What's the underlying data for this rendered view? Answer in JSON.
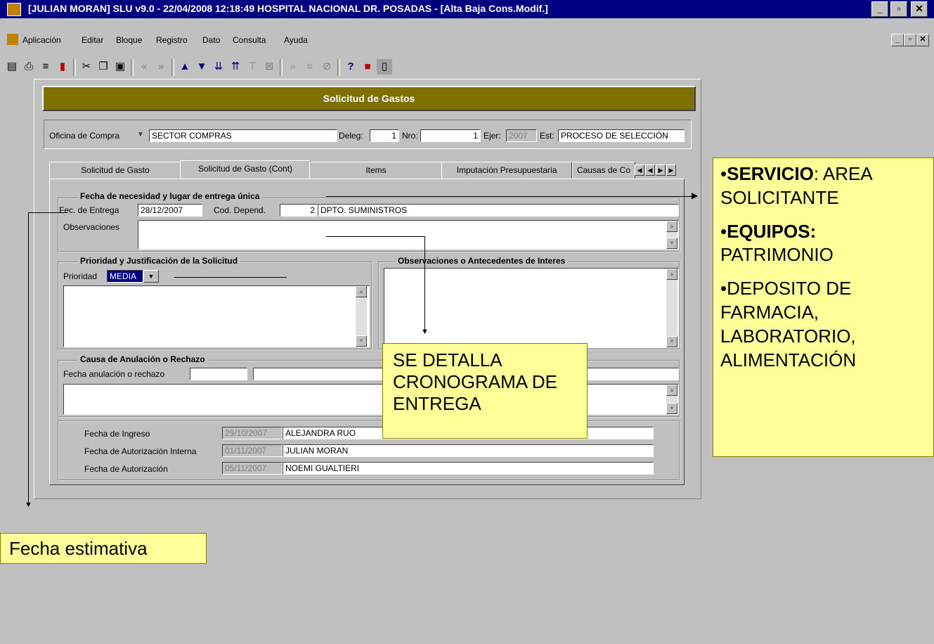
{
  "window": {
    "title": "[JULIAN MORAN]  SLU v9.0 - 22/04/2008 12:18:49 HOSPITAL NACIONAL DR. POSADAS - [Alta Baja Cons.Modif.]"
  },
  "menu": [
    "Aplicación",
    "Editar",
    "Bloque",
    "Registro",
    "Dato",
    "Consulta",
    "Ayuda"
  ],
  "form": {
    "title": "Solicitud de Gastos",
    "header": {
      "oficina_label": "Oficina de Compra",
      "oficina_value": "SECTOR COMPRAS",
      "deleg_label": "Deleg:",
      "deleg_value": "1",
      "nro_label": "Nro:",
      "nro_value": "1",
      "ejer_label": "Ejer:",
      "ejer_value": "2007",
      "est_label": "Est:",
      "est_value": "PROCESO DE SELECCIÓN"
    },
    "tabs": [
      "Solicitud de Gasto",
      "Solicitud de Gasto (Cont)",
      "Items",
      "Imputación Presupuestaria",
      "Causas de Co"
    ],
    "fecha_group": {
      "title": "Fecha de necesidad y lugar de entrega única",
      "fec_entrega_label": "Fec. de Entrega",
      "fec_entrega_value": "28/12/2007",
      "cod_depend_label": "Cod. Depend.",
      "cod_depend_value": "2",
      "depend_name": "DPTO. SUMINISTROS",
      "observaciones_label": "Observaciones"
    },
    "prioridad_group": {
      "title": "Prioridad y Justificación de la Solicitud",
      "prioridad_label": "Prioridad",
      "prioridad_value": "MEDIA"
    },
    "obs_group": {
      "title": "Observaciones o Antecedentes de Interes"
    },
    "anulacion_group": {
      "title": "Causa de Anulación o Rechazo",
      "fecha_label": "Fecha anulación o rechazo"
    },
    "audit": [
      {
        "label": "Fecha de Ingreso",
        "date": "29/10/2007",
        "user": "ALEJANDRA RUO"
      },
      {
        "label": "Fecha de Autorización Interna",
        "date": "01/11/2007",
        "user": "JULIAN MORAN"
      },
      {
        "label": "Fecha de Autorización",
        "date": "05/11/2007",
        "user": "NOEMI GUALTIERI"
      }
    ]
  },
  "callouts": {
    "right": {
      "servicio_bold": "SERVICIO",
      "servicio_rest": ": AREA SOLICITANTE",
      "equipos_bold": "EQUIPOS:",
      "equipos_rest": "PATRIMONIO",
      "deposito": "DEPOSITO DE FARMACIA, LABORATORIO, ALIMENTACIÓN"
    },
    "center": "SE DETALLA CRONOGRAMA DE ENTREGA",
    "left": "Fecha estimativa"
  },
  "colors": {
    "titlebar": "#000080",
    "form_title": "#7b7000",
    "callout": "#ffff99",
    "selection": "#000080"
  }
}
